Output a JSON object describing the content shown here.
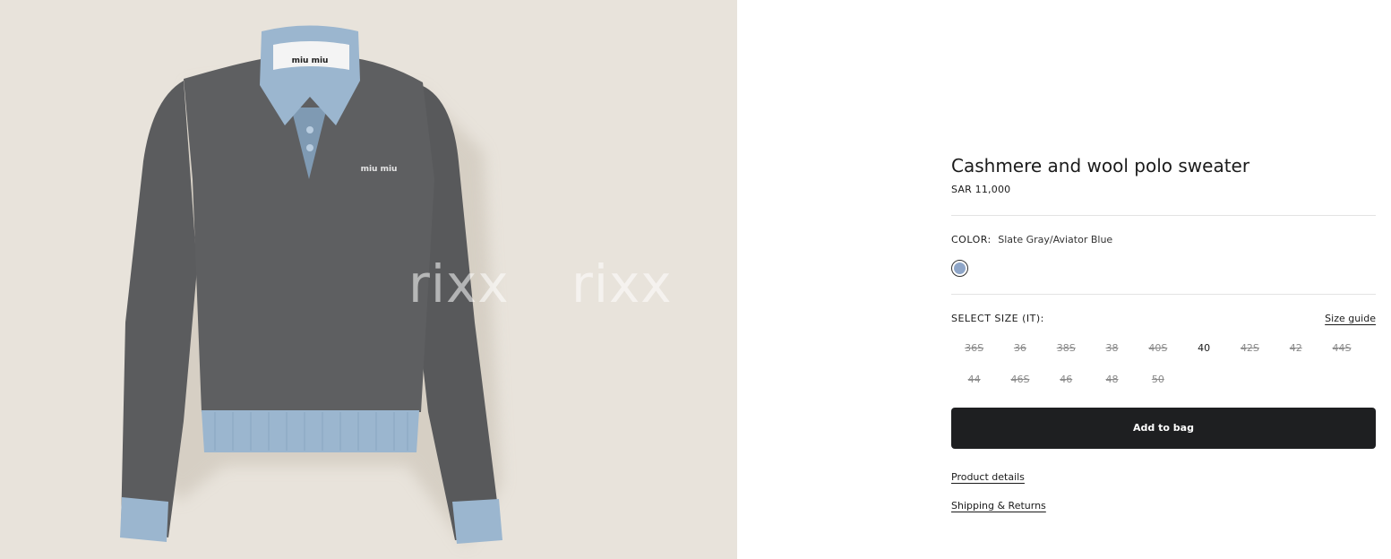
{
  "product": {
    "title": "Cashmere and wool polo sweater",
    "price": "SAR 11,000"
  },
  "image": {
    "watermark_left": "rixx",
    "watermark_right": "rixx",
    "chest_logo": "miu miu",
    "neck_label": "miu miu"
  },
  "color": {
    "label": "COLOR:",
    "value": "Slate Gray/Aviator Blue",
    "swatch_color": "#8fa6c8"
  },
  "size": {
    "label": "SELECT SIZE (IT):",
    "guide_label": "Size guide",
    "options": [
      {
        "label": "36S",
        "available": false
      },
      {
        "label": "36",
        "available": false
      },
      {
        "label": "38S",
        "available": false
      },
      {
        "label": "38",
        "available": false
      },
      {
        "label": "40S",
        "available": false
      },
      {
        "label": "40",
        "available": true
      },
      {
        "label": "42S",
        "available": false
      },
      {
        "label": "42",
        "available": false
      },
      {
        "label": "44S",
        "available": false
      },
      {
        "label": "44",
        "available": false
      },
      {
        "label": "46S",
        "available": false
      },
      {
        "label": "46",
        "available": false
      },
      {
        "label": "48",
        "available": false
      },
      {
        "label": "50",
        "available": false
      }
    ]
  },
  "actions": {
    "add_to_bag": "Add to bag",
    "product_details": "Product details",
    "shipping_returns": "Shipping & Returns"
  },
  "colors": {
    "sweater_body": "#58595b",
    "collar_trim": "#9bb6cf",
    "background": "#e8e3db"
  }
}
